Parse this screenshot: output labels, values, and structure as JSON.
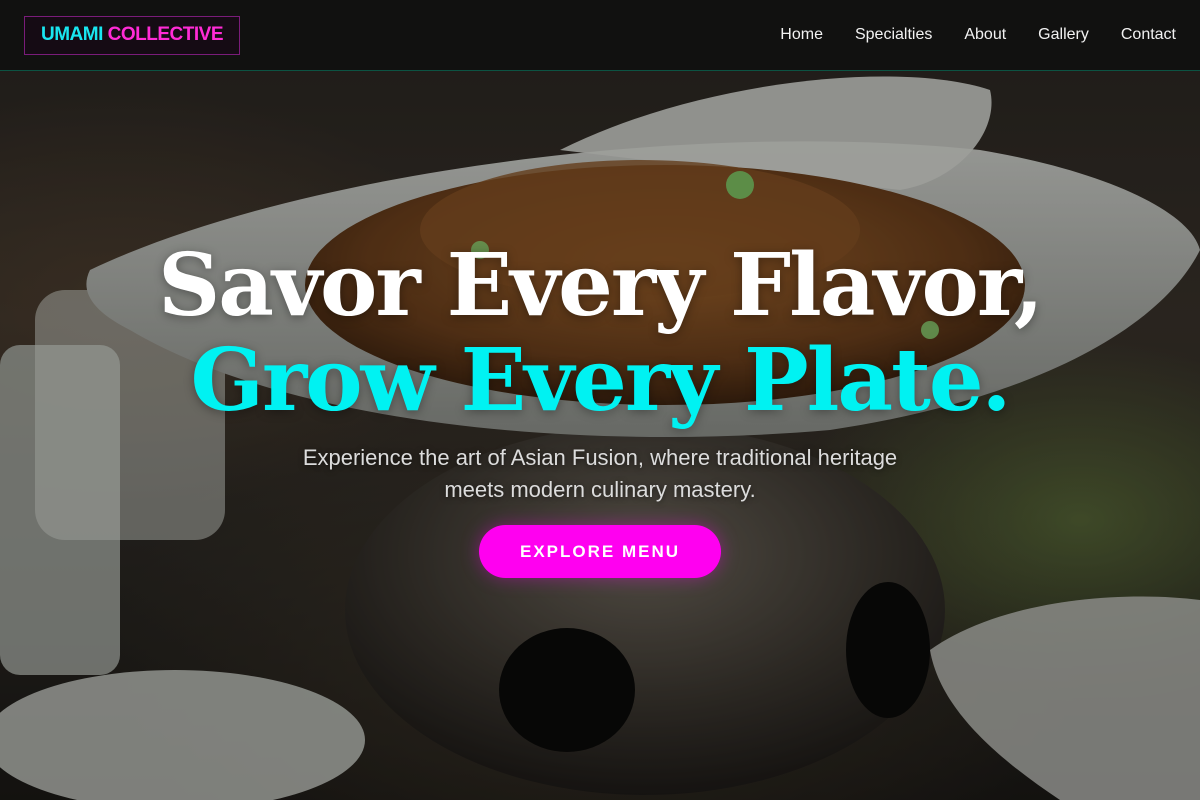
{
  "brand": {
    "word1": "UMAMI",
    "word2": "COLLECTIVE",
    "accent_cyan": "#19e6f0",
    "accent_magenta": "#ff2bd6"
  },
  "nav": {
    "items": [
      {
        "label": "Home"
      },
      {
        "label": "Specialties"
      },
      {
        "label": "About"
      },
      {
        "label": "Gallery"
      },
      {
        "label": "Contact"
      }
    ]
  },
  "hero": {
    "headline_line1": "Savor Every Flavor,",
    "headline_line2": "Grow Every Plate.",
    "subtitle": "Experience the art of Asian Fusion, where traditional heritage meets modern culinary mastery.",
    "cta_label": "EXPLORE MENU",
    "headline_colors": {
      "line1": "#ffffff",
      "line2": "#00f2f2"
    },
    "cta_color": "#ff00f0"
  }
}
